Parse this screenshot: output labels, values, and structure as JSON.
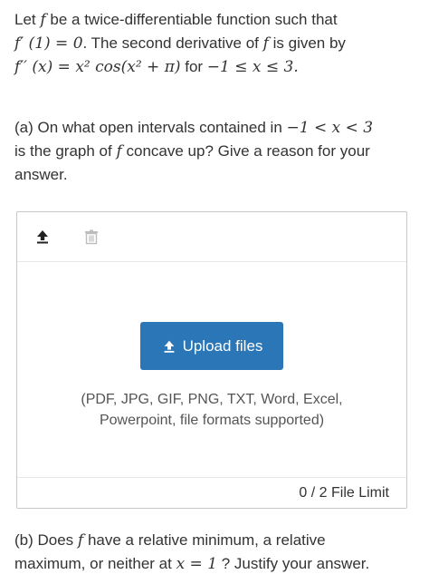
{
  "intro": {
    "t1": "Let ",
    "f": "f",
    "t2": " be a twice-differentiable function such that",
    "fprime_eq": "f′ (1) = 0",
    "t3": ". The second derivative of ",
    "t4": " is given by",
    "fdouble_eq": "f′′ (x) = x² cos(x² + π)",
    "t5": " for ",
    "domain": "−1 ≤ x ≤ 3."
  },
  "part_a": {
    "t1": "(a)  On what open intervals contained in ",
    "interval": "−1 < x < 3",
    "t2": "is the graph of ",
    "f": "f",
    "t3": " concave up? Give a reason for your",
    "t4": "answer."
  },
  "upload": {
    "upload_icon": "upload-icon",
    "trash_icon": "trash-icon",
    "button_label": "Upload files",
    "formats_line1": "(PDF, JPG, GIF, PNG, TXT, Word, Excel,",
    "formats_line2": "Powerpoint, file formats supported)",
    "file_limit": "0 / 2 File Limit",
    "button_color": "#2a76b6"
  },
  "part_b": {
    "t1": "(b)  Does ",
    "f": "f",
    "t2": " have a relative minimum, a relative",
    "t3": "maximum, or neither at ",
    "x_eq": "x = 1",
    "t4": " ? Justify your answer."
  }
}
